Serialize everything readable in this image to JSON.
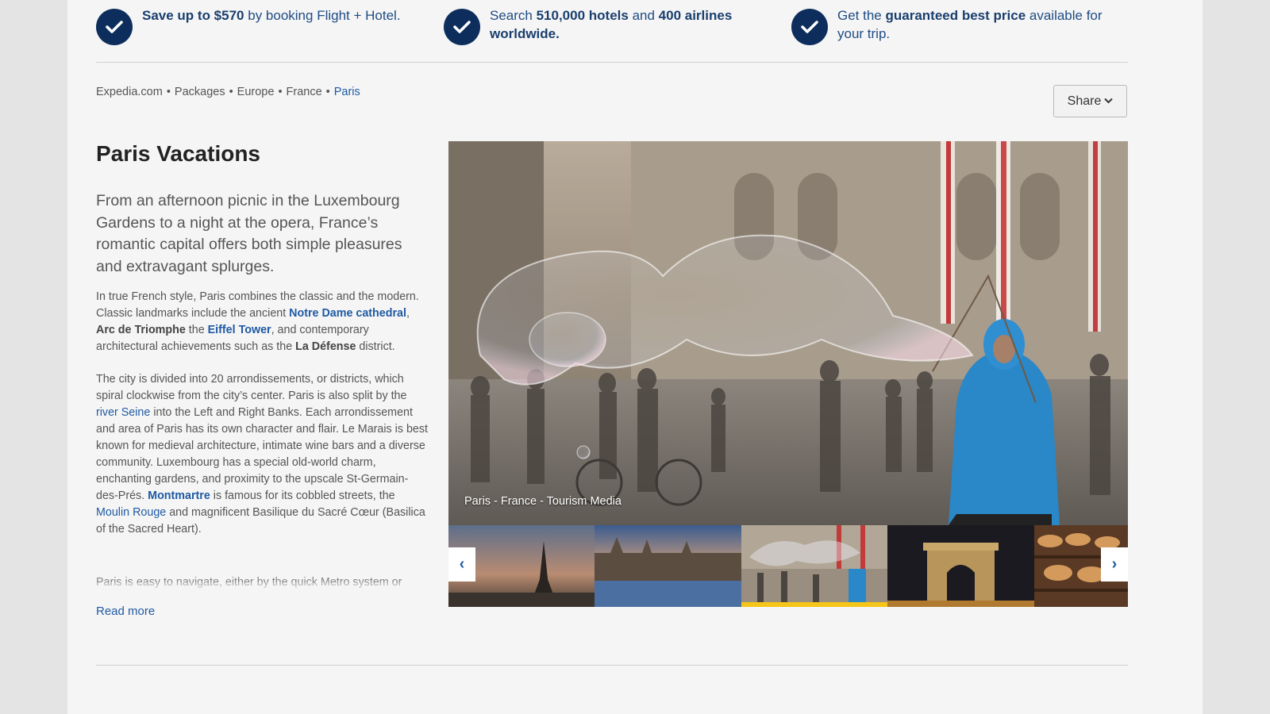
{
  "features": [
    {
      "icon": "checkmark-icon",
      "parts": [
        {
          "t": "Save up to $570",
          "b": true
        },
        {
          "t": " by booking Flight + Hotel.",
          "b": false
        }
      ]
    },
    {
      "icon": "checkmark-icon",
      "parts": [
        {
          "t": "Search ",
          "b": false
        },
        {
          "t": "510,000 hotels",
          "b": true
        },
        {
          "t": " and ",
          "b": false
        },
        {
          "t": "400 airlines worldwide.",
          "b": true
        }
      ]
    },
    {
      "icon": "checkmark-icon",
      "parts": [
        {
          "t": "Get the ",
          "b": false
        },
        {
          "t": "guaranteed best price",
          "b": true
        },
        {
          "t": " available for your trip.",
          "b": false
        }
      ]
    }
  ],
  "breadcrumb": {
    "items": [
      "Expedia.com",
      "Packages",
      "Europe",
      "France"
    ],
    "current": "Paris",
    "separator": "•"
  },
  "share": {
    "label": "Share",
    "icon": "chevron-down-icon"
  },
  "page_title": "Paris Vacations",
  "lead": "From an afternoon picnic in the Luxembourg Gardens to a night at the opera, France’s romantic capital offers both simple pleasures and extravagant splurges.",
  "paragraphs": [
    [
      {
        "t": "In true French style, Paris combines the classic and the modern. Classic landmarks include the ancient "
      },
      {
        "t": "Notre Dame cathedral",
        "link": true,
        "bold": true
      },
      {
        "t": ", "
      },
      {
        "t": "Arc de Triomphe",
        "bold": true
      },
      {
        "t": " the "
      },
      {
        "t": "Eiffel Tower",
        "link": true,
        "bold": true
      },
      {
        "t": ", and contemporary architectural achievements such as the "
      },
      {
        "t": "La Défense",
        "bold": true
      },
      {
        "t": " district."
      }
    ],
    [
      {
        "t": "The city is divided into 20 arrondissements, or districts, which spiral clockwise from the city’s center. Paris is also split by the "
      },
      {
        "t": "river Seine",
        "link": true
      },
      {
        "t": " into the Left and Right Banks. Each arrondissement and area of Paris has its own character and flair. Le Marais is best known for medieval architecture, intimate wine bars and a diverse community. Luxembourg has a special old-world charm, enchanting gardens, and proximity to the upscale St-Germain-des-Prés. "
      },
      {
        "t": "Montmartre",
        "link": true,
        "bold": true
      },
      {
        "t": " is famous for its cobbled streets, the "
      },
      {
        "t": "Moulin Rouge",
        "link": true
      },
      {
        "t": " and magnificent Basilique du Sacré Cœur (Basilica of the Sacred Heart)."
      }
    ]
  ],
  "fade_paragraph": "Paris is easy to navigate, either by the quick Metro system or",
  "read_more": "Read more",
  "gallery": {
    "caption": "Paris - France - Tourism Media",
    "prev_icon": "chevron-left-icon",
    "next_icon": "chevron-right-icon",
    "prev_glyph": "‹",
    "next_glyph": "›",
    "thumbnails": [
      {
        "name": "thumb-eiffel-tower",
        "selected": false
      },
      {
        "name": "thumb-seine-conciergerie",
        "selected": false
      },
      {
        "name": "thumb-bubble-performer",
        "selected": true
      },
      {
        "name": "thumb-arc-de-triomphe",
        "selected": false
      },
      {
        "name": "thumb-bakery-bread",
        "selected": false
      }
    ]
  },
  "colors": {
    "check_circle": "#0d2e5c",
    "link": "#1f5aa3",
    "selected_thumb_bar": "#f5c518",
    "page_bg": "#f5f5f5"
  }
}
